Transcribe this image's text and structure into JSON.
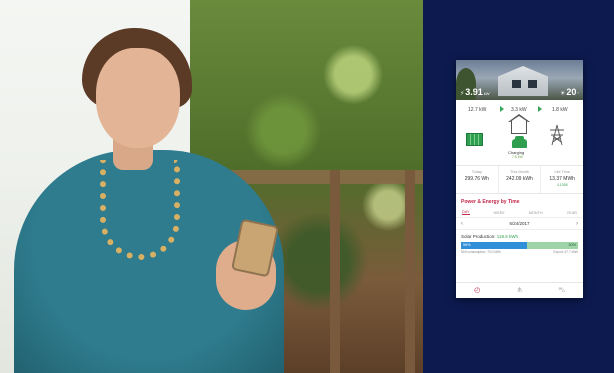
{
  "hero": {
    "left_value": "3.91",
    "left_unit": "kW",
    "left_icon": "lightning-icon",
    "right_value": "20",
    "right_unit": "°",
    "right_icon": "sun-icon"
  },
  "flow": {
    "solar_kw": "12.7 kW",
    "home_kw": "3.3 kW",
    "grid_kw": "1.8 kW",
    "car_label": "Charging",
    "car_sub": "7.6 kW"
  },
  "totals": [
    {
      "label": "Today",
      "value": "299.76 Wh",
      "sub": ""
    },
    {
      "label": "This Month",
      "value": "242.09 kWh",
      "sub": ""
    },
    {
      "label": "Life Time",
      "value": "13.37 MWh",
      "sub": "4.1358"
    }
  ],
  "chart_section": {
    "title": "Power & Energy by Time",
    "tabs": [
      "DAY",
      "WEEK",
      "MONTH",
      "YEAR"
    ],
    "active_tab": 0,
    "date": "6/24/2017"
  },
  "production": {
    "label": "Solar Production:",
    "value": "118.6 kWh",
    "self_pct": "56%",
    "export_pct": "30%",
    "self_fraction": 0.56,
    "foot_left": "Self consumption: 70.0 kWh",
    "foot_right": "Export: 47.7 kWh"
  },
  "nav": [
    "gauge-icon",
    "network-icon",
    "car-icon"
  ],
  "colors": {
    "navy": "#0c1a4f",
    "accent": "#c2294a",
    "green": "#2f9e4f",
    "blue": "#2f8fd8"
  }
}
